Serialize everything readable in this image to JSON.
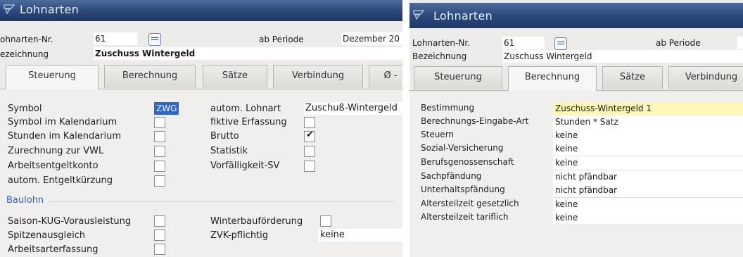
{
  "left": {
    "window_title": "Lohnarten",
    "labels": {
      "nr": "ohnarten-Nr.",
      "bezeichnung": "ezeichnung",
      "ab_periode": "ab Periode"
    },
    "values": {
      "nr": "61",
      "bezeichnung": "Zuschuss Wintergeld",
      "periode": "Dezember 20"
    },
    "tabs": [
      "Steuerung",
      "Berechnung",
      "Sätze",
      "Verbindung",
      "Ø -"
    ],
    "steuerung_left": [
      {
        "label": "Symbol",
        "value": "ZWG"
      },
      {
        "label": "Symbol im Kalendarium",
        "checked": false
      },
      {
        "label": "Stunden im Kalendarium",
        "checked": false
      },
      {
        "label": "Zurechnung zur VWL",
        "checked": false
      },
      {
        "label": "Arbeitsentgeltkonto",
        "checked": false
      },
      {
        "label": "autom. Entgeltkürzung",
        "checked": false
      }
    ],
    "steuerung_right": [
      {
        "label": "autom. Lohnart",
        "value": "Zuschuß-Wintergeld"
      },
      {
        "label": "fiktive Erfassung",
        "checked": false
      },
      {
        "label": "Brutto",
        "checked": true
      },
      {
        "label": "Statistik",
        "checked": false
      },
      {
        "label": "Vorfälligkeit-SV",
        "checked": false
      }
    ],
    "section_baulohn": "Baulohn",
    "baulohn_left": [
      {
        "label": "Saison-KUG-Vorausleistung",
        "checked": false
      },
      {
        "label": "Spitzenausgleich",
        "checked": false
      },
      {
        "label": "Arbeitsarterfassung",
        "checked": false
      }
    ],
    "baulohn_right": [
      {
        "label": "Winterbauförderung",
        "checked": false
      },
      {
        "label": "ZVK-pflichtig",
        "value": "keine"
      }
    ]
  },
  "right": {
    "window_title": "Lohnarten",
    "labels": {
      "nr": "Lohnarten-Nr.",
      "bezeichnung": "Bezeichnung",
      "ab_periode": "ab Periode"
    },
    "values": {
      "nr": "61",
      "bezeichnung": "Zuschuss Wintergeld"
    },
    "tabs": [
      "Steuerung",
      "Berechnung",
      "Sätze",
      "Verbindung"
    ],
    "rows": [
      {
        "label": "Bestimmung",
        "value": "Zuschuss-Wintergeld 1",
        "highlight": true
      },
      {
        "label": "Berechnungs-Eingabe-Art",
        "value": "Stunden * Satz"
      },
      {
        "label": "Steuern",
        "value": "keine"
      },
      {
        "label": "Sozial-Versicherung",
        "value": "keine"
      },
      {
        "label": "Berufsgenossenschaft",
        "value": "keine"
      },
      {
        "label": "Sachpfändung",
        "value": "nicht pfändbar"
      },
      {
        "label": "Unterhaltspfändung",
        "value": "nicht pfändbar"
      },
      {
        "label": "Altersteilzeit gesetzlich",
        "value": "keine"
      },
      {
        "label": "Altersteilzeit tariflich",
        "value": "keine"
      }
    ]
  },
  "colors": {
    "titlebar": "#2c4a7c",
    "section_blue": "#2a5fc9",
    "symbol_highlight": "#2f66c9",
    "bestimmung_highlight": "#fff7b3"
  },
  "icons": [
    "window-icon",
    "list-lookup-icon",
    "checkbox-checked-icon"
  ]
}
